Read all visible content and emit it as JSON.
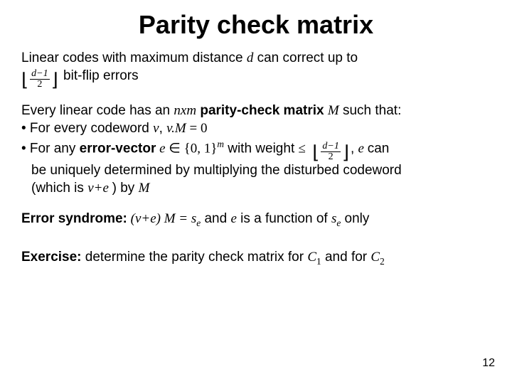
{
  "title": "Parity check matrix",
  "p1a": "Linear codes with maximum distance ",
  "p1b": " can correct up to",
  "p1c": " bit-flip errors",
  "d": "d",
  "frac_num": "d−1",
  "frac_den": "2",
  "p2a": "Every linear code has an ",
  "nxm": "nxm",
  "p2b": " parity-check matrix ",
  "M": "M",
  "p2c": " such that:",
  "b1a": "• For every codeword ",
  "v": "v",
  "comma_sp": ", ",
  "vM": "v.M",
  "eq0": " = 0",
  "b2a": "• For any ",
  "b2err": "error-vector",
  "e": " e ",
  "in": "∈",
  "set": " {0, 1}",
  "m": "m",
  "b2b": " with weight ",
  "le": "≤",
  "b2c": ",  ",
  "b2d": " can",
  "b2e": "be uniquely determined by multiplying the disturbed codeword",
  "b2f": "(which is ",
  "vpe": "v+e ",
  "b2g": ") by ",
  "err_label": "Error syndrome:",
  "err_eq1": " (v+e) M = s",
  "sub_e": "e",
  "err_and": "  and  ",
  "err_e": "e",
  "err_txt": " is a function of ",
  "err_s": "s",
  "err_only": " only",
  "ex_label": "Exercise:",
  "ex_txt": " determine the parity check matrix for ",
  "C": "C",
  "one": "1",
  "and_for": " and for ",
  "two": "2",
  "pagenum": "12",
  "leading_minus": ""
}
